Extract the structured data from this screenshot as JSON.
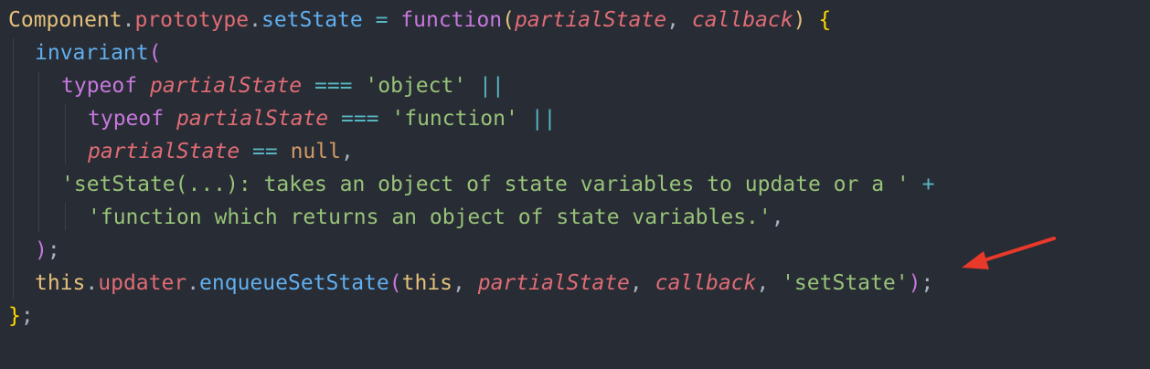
{
  "theme": {
    "background": "#282c34",
    "keyword": "#c678dd",
    "function": "#61afef",
    "string": "#98c379",
    "parameter": "#e06c75",
    "object": "#e5c07b",
    "operator": "#56b6c2",
    "annotation_arrow": "#e8392b"
  },
  "code": {
    "line1": {
      "t1": "Component",
      "t2": ".",
      "t3": "prototype",
      "t4": ".",
      "t5": "setState",
      "t6": " = ",
      "t7": "function",
      "t8": "(",
      "t9": "partialState",
      "t10": ", ",
      "t11": "callback",
      "t12": ")",
      "t13": " ",
      "t14": "{"
    },
    "line2": {
      "t1": "invariant",
      "t2": "("
    },
    "line3": {
      "t1": "typeof",
      "t2": " ",
      "t3": "partialState",
      "t4": " === ",
      "t5": "'object'",
      "t6": " ||"
    },
    "line4": {
      "t1": "typeof",
      "t2": " ",
      "t3": "partialState",
      "t4": " === ",
      "t5": "'function'",
      "t6": " ||"
    },
    "line5": {
      "t1": "partialState",
      "t2": " == ",
      "t3": "null",
      "t4": ","
    },
    "line6": {
      "t1": "'setState(...): takes an object of state variables to update or a '",
      "t2": " +"
    },
    "line7": {
      "t1": "'function which returns an object of state variables.'",
      "t2": ","
    },
    "line8": {
      "t1": ")",
      "t2": ";"
    },
    "line9": {
      "t1": "this",
      "t2": ".",
      "t3": "updater",
      "t4": ".",
      "t5": "enqueueSetState",
      "t6": "(",
      "t7": "this",
      "t8": ", ",
      "t9": "partialState",
      "t10": ", ",
      "t11": "callback",
      "t12": ", ",
      "t13": "'setState'",
      "t14": ")",
      "t15": ";"
    },
    "line10": {
      "t1": "}",
      "t2": ";"
    }
  },
  "annotation": {
    "type": "arrow",
    "points_to": "line9"
  }
}
